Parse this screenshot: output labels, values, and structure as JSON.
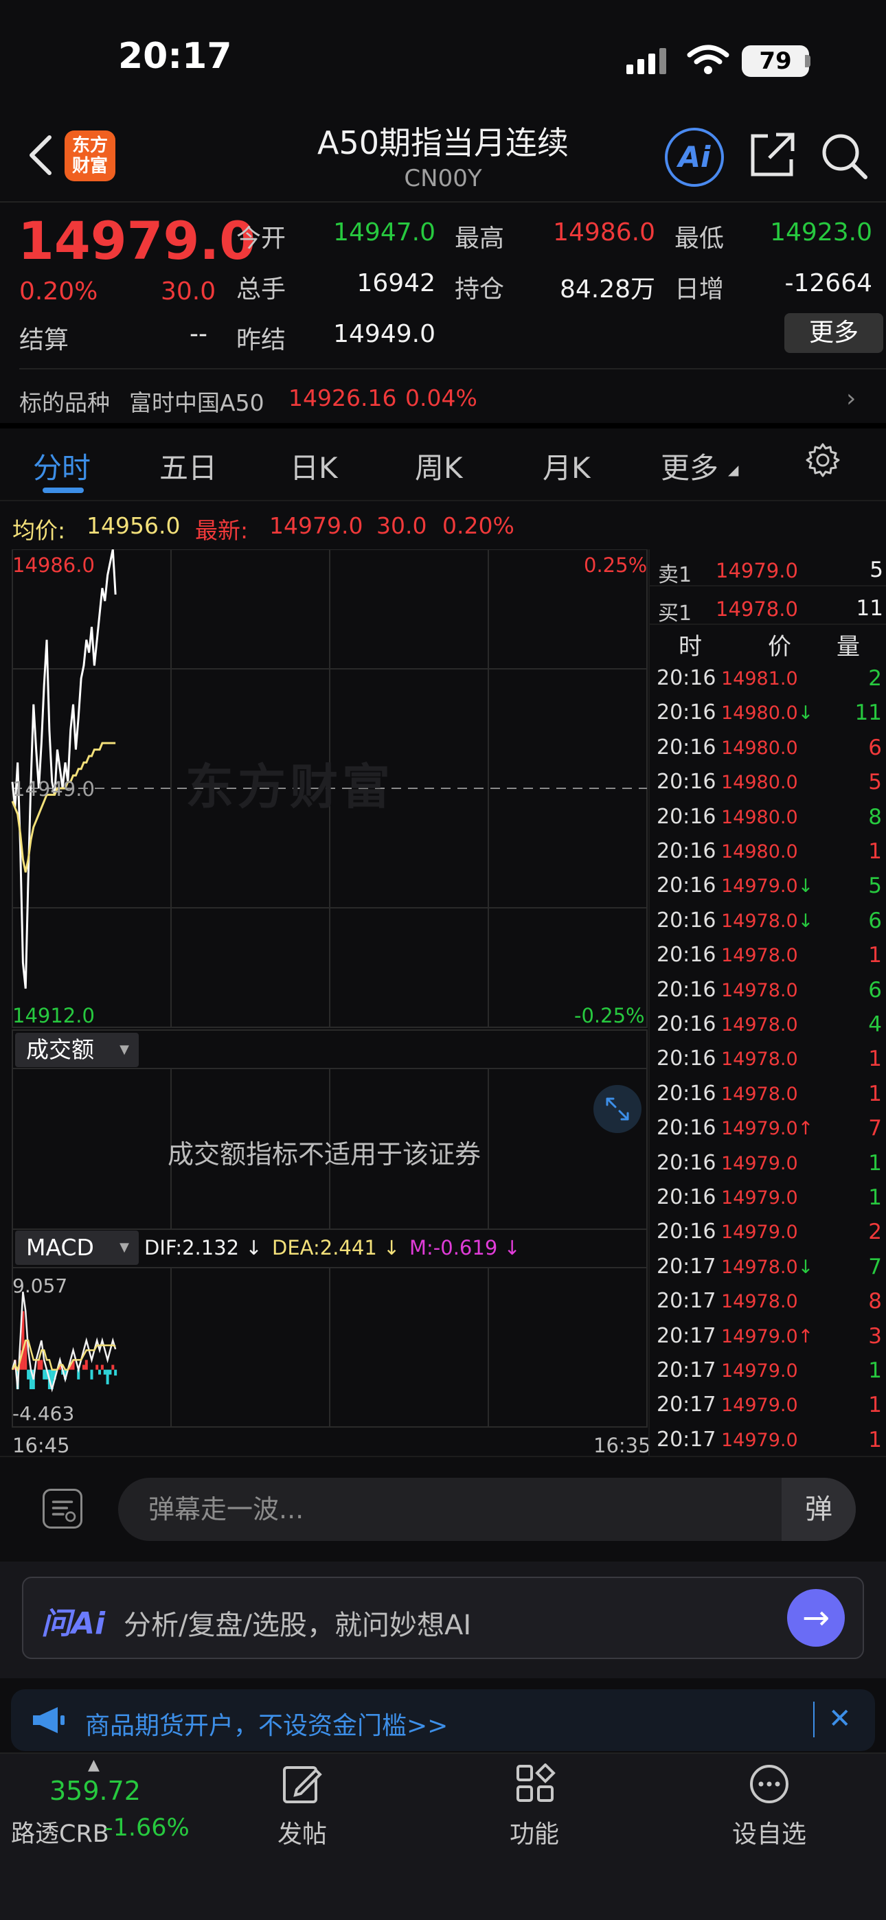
{
  "status_bar": {
    "time": "20:17",
    "battery": "79"
  },
  "header": {
    "logo_text": "东方\n财富",
    "title": "A50期指当月连续",
    "code": "CN00Y",
    "ai_label": "Ai"
  },
  "quote": {
    "price": "14979.0",
    "change_pct": "0.20%",
    "change_abs": "30.0",
    "settle_label": "结算",
    "settle_value": "--",
    "rows": [
      [
        {
          "label": "今开",
          "value": "14947.0",
          "color": "green"
        },
        {
          "label": "最高",
          "value": "14986.0",
          "color": "red"
        },
        {
          "label": "最低",
          "value": "14923.0",
          "color": "green"
        }
      ],
      [
        {
          "label": "总手",
          "value": "16942",
          "color": "white"
        },
        {
          "label": "持仓",
          "value": "84.28万",
          "color": "white"
        },
        {
          "label": "日增",
          "value": "-12664",
          "color": "white"
        }
      ],
      [
        {
          "label": "昨结",
          "value": "14949.0",
          "color": "white"
        }
      ]
    ],
    "more_label": "更多",
    "underlying_label": "标的品种",
    "underlying_name": "富时中国A50",
    "underlying_price": "14926.16",
    "underlying_pct": "0.04%"
  },
  "tabs": [
    "分时",
    "五日",
    "日K",
    "周K",
    "月K",
    "更多"
  ],
  "chart_info": {
    "avg_label": "均价:",
    "avg_value": "14956.0",
    "latest_label": "最新:",
    "latest_value": "14979.0",
    "latest_chg": "30.0",
    "latest_pct": "0.20%"
  },
  "chart_data": {
    "type": "line",
    "title": "",
    "xlabel": "",
    "ylabel": "",
    "ylim": [
      14912.0,
      14986.0
    ],
    "prev_close": "14949.0",
    "ymax_label": "14986.0",
    "ymin_label": "14912.0",
    "ymax_pct": "0.25%",
    "ymin_pct": "-0.25%",
    "x_start_label": "16:45",
    "x_end_label": "16:35",
    "series": [
      {
        "name": "",
        "color": "#ffffff",
        "values": [
          14950,
          14946,
          14953,
          14940,
          14922,
          14918,
          14935,
          14950,
          14962,
          14955,
          14949,
          14956,
          14965,
          14972,
          14958,
          14950,
          14948,
          14955,
          14952,
          14949,
          14953,
          14950,
          14958,
          14962,
          14955,
          14960,
          14966,
          14968,
          14972,
          14970,
          14974,
          14968,
          14972,
          14976,
          14980,
          14978,
          14982,
          14984,
          14986,
          14979
        ]
      },
      {
        "name": "",
        "color": "#f3e07a",
        "values": [
          14947,
          14946,
          14945,
          14942,
          14938,
          14936,
          14938,
          14941,
          14943,
          14944,
          14945,
          14946,
          14947,
          14948,
          14948,
          14948,
          14948,
          14949,
          14949,
          14949,
          14949,
          14950,
          14950,
          14951,
          14951,
          14952,
          14952,
          14953,
          14953,
          14954,
          14954,
          14955,
          14955,
          14955,
          14956,
          14956,
          14956,
          14956,
          14956,
          14956
        ]
      }
    ],
    "macd": {
      "dif_label": "DIF:2.132 ↓",
      "dea_label": "DEA:2.441 ↓",
      "m_label": "M:-0.619 ↓",
      "ylim": [
        -4.463,
        9.057
      ],
      "max_label": "9.057",
      "min_label": "-4.463",
      "dif": [
        0,
        1,
        -2,
        3,
        8,
        6,
        2,
        0,
        -1,
        1,
        2,
        3,
        1,
        0,
        -1,
        -2,
        -1,
        0,
        1,
        0,
        -1,
        0,
        1,
        2,
        1,
        0,
        1,
        2,
        3,
        2,
        1,
        2,
        3,
        2,
        3,
        2,
        1,
        2,
        3,
        2.1
      ],
      "dea": [
        0,
        0.5,
        0,
        1,
        2,
        3,
        3,
        2,
        1,
        1,
        1,
        2,
        2,
        1,
        1,
        0,
        0,
        0,
        0.5,
        0.5,
        0,
        0,
        0.5,
        1,
        1,
        1,
        1,
        1.5,
        2,
        2,
        2,
        2,
        2.5,
        2.5,
        2.5,
        2.5,
        2.5,
        2.5,
        2.5,
        2.4
      ],
      "hist": [
        0,
        1,
        -2,
        2,
        6,
        3,
        -1,
        -2,
        -2,
        0,
        1,
        1,
        -1,
        -1,
        -2,
        -2,
        -1,
        0,
        0.5,
        -0.5,
        -1,
        0,
        0.5,
        1,
        0,
        -1,
        0,
        0.5,
        1,
        0,
        -1,
        0,
        0.5,
        -0.5,
        0.5,
        -0.5,
        -1.5,
        -0.5,
        0.5,
        -0.6
      ]
    }
  },
  "indicators": {
    "turnover_label": "成交额",
    "turnover_message": "成交额指标不适用于该证券",
    "macd_label": "MACD"
  },
  "watermark": "东方财富",
  "order_book": {
    "ask": {
      "label": "卖1",
      "price": "14979.0",
      "qty": "5"
    },
    "bid": {
      "label": "买1",
      "price": "14978.0",
      "qty": "11"
    },
    "headers": [
      "时",
      "价",
      "量"
    ],
    "ticks": [
      {
        "time": "20:16",
        "price": "14981.0",
        "arrow": "",
        "qty": "2",
        "qty_color": "green"
      },
      {
        "time": "20:16",
        "price": "14980.0",
        "arrow": "↓",
        "qty": "11",
        "qty_color": "green"
      },
      {
        "time": "20:16",
        "price": "14980.0",
        "arrow": "",
        "qty": "6",
        "qty_color": "red"
      },
      {
        "time": "20:16",
        "price": "14980.0",
        "arrow": "",
        "qty": "5",
        "qty_color": "red"
      },
      {
        "time": "20:16",
        "price": "14980.0",
        "arrow": "",
        "qty": "8",
        "qty_color": "green"
      },
      {
        "time": "20:16",
        "price": "14980.0",
        "arrow": "",
        "qty": "1",
        "qty_color": "red"
      },
      {
        "time": "20:16",
        "price": "14979.0",
        "arrow": "↓",
        "qty": "5",
        "qty_color": "green"
      },
      {
        "time": "20:16",
        "price": "14978.0",
        "arrow": "↓",
        "qty": "6",
        "qty_color": "green"
      },
      {
        "time": "20:16",
        "price": "14978.0",
        "arrow": "",
        "qty": "1",
        "qty_color": "red"
      },
      {
        "time": "20:16",
        "price": "14978.0",
        "arrow": "",
        "qty": "6",
        "qty_color": "green"
      },
      {
        "time": "20:16",
        "price": "14978.0",
        "arrow": "",
        "qty": "4",
        "qty_color": "green"
      },
      {
        "time": "20:16",
        "price": "14978.0",
        "arrow": "",
        "qty": "1",
        "qty_color": "red"
      },
      {
        "time": "20:16",
        "price": "14978.0",
        "arrow": "",
        "qty": "1",
        "qty_color": "red"
      },
      {
        "time": "20:16",
        "price": "14979.0",
        "arrow": "↑",
        "qty": "7",
        "qty_color": "red"
      },
      {
        "time": "20:16",
        "price": "14979.0",
        "arrow": "",
        "qty": "1",
        "qty_color": "green"
      },
      {
        "time": "20:16",
        "price": "14979.0",
        "arrow": "",
        "qty": "1",
        "qty_color": "green"
      },
      {
        "time": "20:16",
        "price": "14979.0",
        "arrow": "",
        "qty": "2",
        "qty_color": "red"
      },
      {
        "time": "20:17",
        "price": "14978.0",
        "arrow": "↓",
        "qty": "7",
        "qty_color": "green"
      },
      {
        "time": "20:17",
        "price": "14978.0",
        "arrow": "",
        "qty": "8",
        "qty_color": "red"
      },
      {
        "time": "20:17",
        "price": "14979.0",
        "arrow": "↑",
        "qty": "3",
        "qty_color": "red"
      },
      {
        "time": "20:17",
        "price": "14979.0",
        "arrow": "",
        "qty": "1",
        "qty_color": "green"
      },
      {
        "time": "20:17",
        "price": "14979.0",
        "arrow": "",
        "qty": "1",
        "qty_color": "red"
      },
      {
        "time": "20:17",
        "price": "14979.0",
        "arrow": "",
        "qty": "1",
        "qty_color": "red"
      }
    ]
  },
  "bottom": {
    "danmaku_placeholder": "弹幕走一波...",
    "danmaku_toggle": "弹",
    "ai_logo": "问Ai",
    "ai_prompt": "分析/复盘/选股，就问妙想AI",
    "promo_text": "商品期货开户，不设资金门槛>>",
    "nav": {
      "ticker_value": "359.72",
      "ticker_name": "路透CRB",
      "ticker_pct": "-1.66%",
      "post_label": "发帖",
      "func_label": "功能",
      "watch_label": "设自选"
    }
  },
  "colors": {
    "red": "#f0393a",
    "green": "#27c93f",
    "accent": "#3d8fe8",
    "avg_line": "#f3e07a"
  }
}
